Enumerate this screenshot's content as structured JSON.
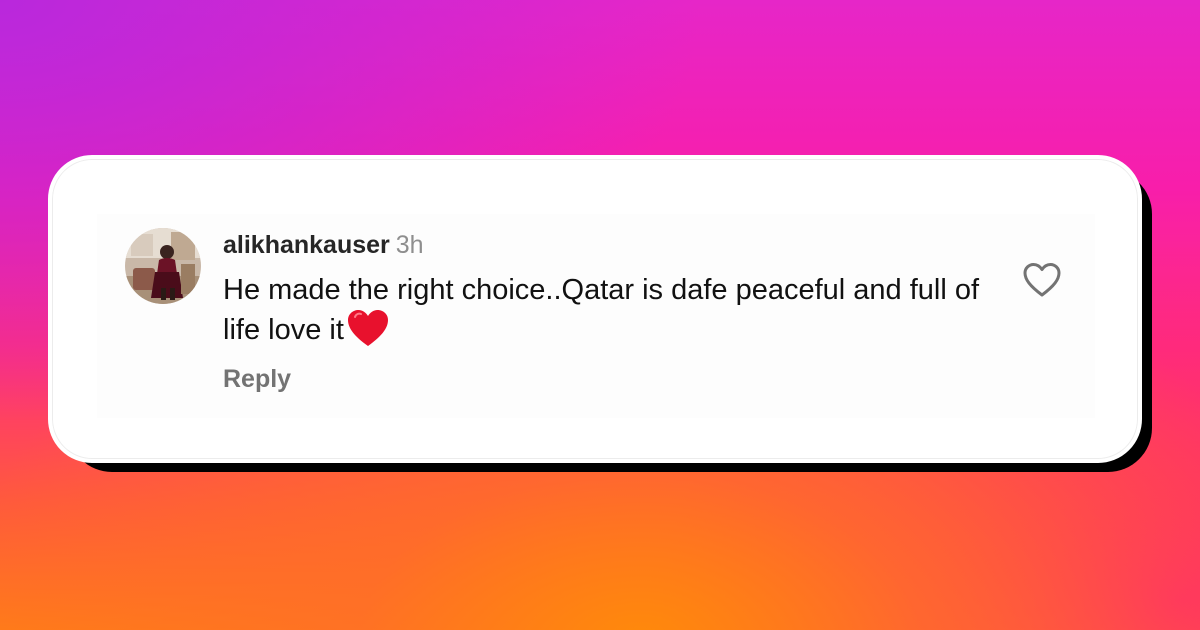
{
  "comment": {
    "username": "alikhankauser",
    "timestamp": "3h",
    "text": "He made the right choice..Qatar is dafe peaceful and full of life love it",
    "emoji": "red-heart-emoji",
    "reply_label": "Reply",
    "avatar": "user-avatar-photo",
    "like_icon": "heart-outline-icon"
  },
  "colors": {
    "background_top": "#e626c8",
    "background_bottom": "#ff7c18",
    "card": "#ffffff",
    "card_shadow": "#000000",
    "username": "#262626",
    "timestamp": "#8e8e8e",
    "reply": "#737373",
    "emoji_heart": "#e8112d"
  }
}
